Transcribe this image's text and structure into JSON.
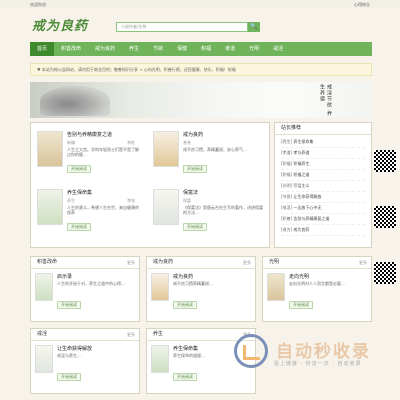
{
  "topbar": {
    "left": "欢迎你进",
    "right": "心得修业"
  },
  "logo": "戒为良药",
  "search": {
    "placeholder": "小说作者/名称",
    "button": "🔍"
  },
  "nav": [
    "首页",
    "积善改命",
    "戒为良药",
    "养生",
    "节欲",
    "保健",
    "积福",
    "孝道",
    "光明",
    "戒淫"
  ],
  "notice": "♥ 本站为纯公益网站，请勿用于商业目的；敬善知识分享 → 心向光明，积善行德，还您健康、快乐、积福！祝福",
  "banner": {
    "ink": "戒淫节欲 养生养德"
  },
  "colors": {
    "accent": "#6fb35a",
    "nav_active": "#3f8a2c"
  },
  "sections": {
    "featured": {
      "books": [
        {
          "title": "告别与养精康复之道",
          "meta": "新编",
          "author": "李姓",
          "desc": "人生之大宫。学的年轻男士们是不是了解过你的健...",
          "btn": "开始阅读"
        },
        {
          "title": "戒为良药",
          "meta": "卷卷",
          "author": "",
          "desc": "戒不良习惯，养精蓄锐、安心养气...",
          "btn": "开始阅读"
        },
        {
          "title": "养生保命集",
          "meta": "养生",
          "author": "李铭",
          "desc": "人生的意义，希望人生在世，来自健康的保养",
          "btn": "开始阅读"
        },
        {
          "title": "保富法",
          "meta": "保富",
          "author": "",
          "desc": "《保富法》是聂云台先生写的著作，讲述保富的方法...",
          "btn": "开始阅读"
        }
      ]
    },
    "list": {
      "title": "站长推荐",
      "rows": [
        {
          "tag": "[养生]",
          "name": "养生保命集",
          "author": ""
        },
        {
          "tag": "[孝道]",
          "name": "孝与养道",
          "author": ""
        },
        {
          "tag": "[积福]",
          "name": "积福养生",
          "author": ""
        },
        {
          "tag": "[积福]",
          "name": "积福之道",
          "author": ""
        },
        {
          "tag": "[光明]",
          "name": "写话主义",
          "author": ""
        },
        {
          "tag": "[节欲]",
          "name": "让生命获得解放",
          "author": ""
        },
        {
          "tag": "[戒淫]",
          "name": "一念放下心中无",
          "author": ""
        },
        {
          "tag": "[积善]",
          "name": "告别与养精康复之道",
          "author": ""
        },
        {
          "tag": "[戒为]",
          "name": "戒为良药",
          "author": ""
        }
      ]
    },
    "row2": [
      {
        "title": "积善改命",
        "more": "更多",
        "book": {
          "title": "启示录",
          "meta": "",
          "desc": "人生的开始于对，养生之道中的心得...",
          "btn": "开始阅读"
        }
      },
      {
        "title": "戒为良药",
        "more": "更多",
        "book": {
          "title": "戒为良药",
          "meta": "",
          "desc": "戒不良习惯养精蓄锐...",
          "btn": "开始阅读"
        }
      },
      {
        "title": "光明",
        "more": "更多",
        "book": {
          "title": "走向光明",
          "meta": "",
          "desc": "走向光明对人人而言都是必要...",
          "btn": "开始阅读"
        }
      }
    ],
    "row3": [
      {
        "title": "戒淫",
        "more": "更多",
        "book": {
          "title": "让生命获得解放",
          "meta": "",
          "desc": "戒淫与养生...",
          "btn": "开始阅读"
        }
      },
      {
        "title": "养生",
        "more": "更多",
        "book": {
          "title": "养生保命集",
          "meta": "",
          "desc": "养生保命的道理...",
          "btn": "开始阅读"
        }
      }
    ]
  },
  "watermark": {
    "text": "自动秒收录",
    "sub": "投上链接 · 秒访一次 · 自动收录"
  }
}
